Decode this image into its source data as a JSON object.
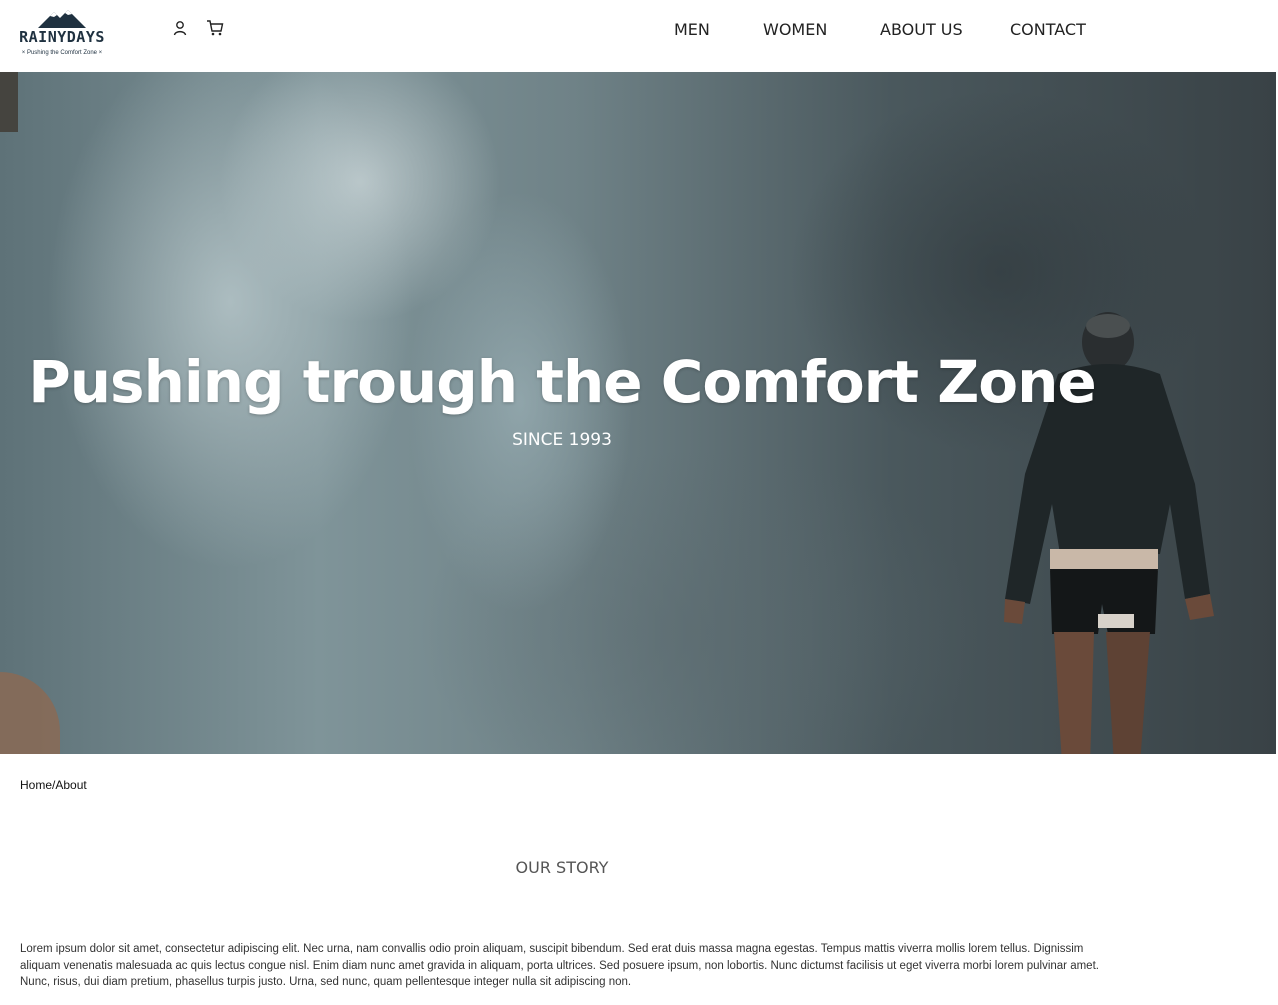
{
  "brand": {
    "name": "RAINYDAYS",
    "tagline": "Pushing the Comfort Zone",
    "color": "#1f3140"
  },
  "header": {
    "icons": [
      "user-icon",
      "cart-icon"
    ],
    "nav": [
      "MEN",
      "WOMEN",
      "ABOUT US",
      "CONTACT"
    ]
  },
  "hero": {
    "title": "Pushing trough the Comfort Zone",
    "subtitle": "SINCE 1993"
  },
  "breadcrumb": {
    "home": "Home",
    "separator": "/",
    "current": "About"
  },
  "story": {
    "heading": "OUR STORY",
    "text": "Lorem ipsum dolor sit amet, consectetur adipiscing elit. Nec urna, nam convallis odio proin aliquam, suscipit bibendum. Sed erat duis massa magna egestas. Tempus mattis viverra mollis lorem tellus. Dignissim aliquam venenatis malesuada ac quis lectus congue nisl. Enim diam nunc amet gravida in aliquam, porta ultrices. Sed posuere ipsum, non lobortis. Nunc dictumst facilisis ut eget viverra morbi lorem pulvinar amet. Nunc, risus, dui diam pretium, phasellus turpis justo. Urna, sed nunc, quam pellentesque integer nulla sit adipiscing non."
  }
}
